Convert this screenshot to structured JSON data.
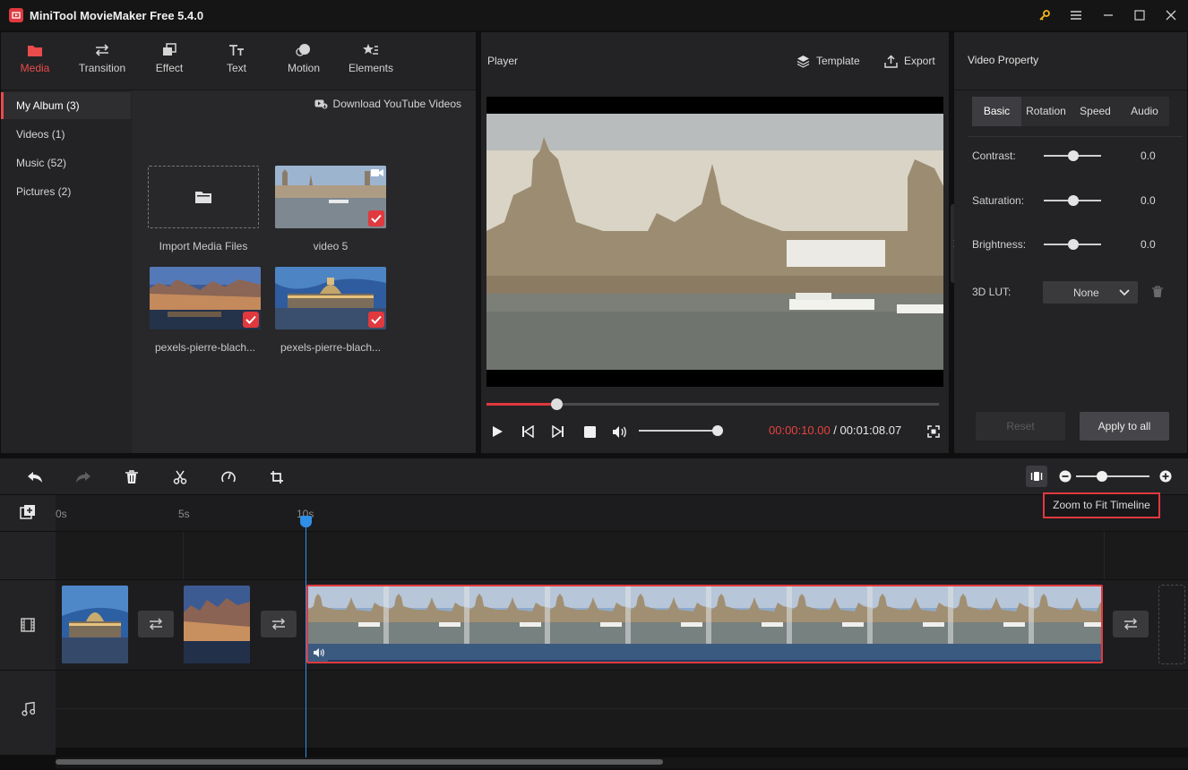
{
  "window": {
    "title": "MiniTool MovieMaker Free 5.4.0"
  },
  "toolbar": {
    "tabs": [
      {
        "label": "Media",
        "icon": "folder-icon"
      },
      {
        "label": "Transition",
        "icon": "transition-arrows-icon"
      },
      {
        "label": "Effect",
        "icon": "effect-icon"
      },
      {
        "label": "Text",
        "icon": "text-icon"
      },
      {
        "label": "Motion",
        "icon": "motion-icon"
      },
      {
        "label": "Elements",
        "icon": "elements-icon"
      }
    ]
  },
  "sidebar": {
    "items": [
      {
        "label": "My Album (3)"
      },
      {
        "label": "Videos (1)"
      },
      {
        "label": "Music (52)"
      },
      {
        "label": "Pictures (2)"
      }
    ]
  },
  "media": {
    "download_label": "Download YouTube Videos",
    "items": [
      {
        "caption": "Import Media Files"
      },
      {
        "caption": "video 5"
      },
      {
        "caption": "pexels-pierre-blach..."
      },
      {
        "caption": "pexels-pierre-blach..."
      }
    ]
  },
  "player": {
    "title": "Player",
    "template_label": "Template",
    "export_label": "Export",
    "current_time": "00:00:10.00",
    "separator": " / ",
    "total_time": "00:01:08.07",
    "progress": 0.155,
    "volume": 0.94
  },
  "properties": {
    "title": "Video Property",
    "tabs": [
      "Basic",
      "Rotation",
      "Speed",
      "Audio"
    ],
    "rows": [
      {
        "label": "Contrast:",
        "value": "0.0"
      },
      {
        "label": "Saturation:",
        "value": "0.0"
      },
      {
        "label": "Brightness:",
        "value": "0.0"
      }
    ],
    "lut_label": "3D LUT:",
    "lut_value": "None",
    "reset_label": "Reset",
    "apply_label": "Apply to all"
  },
  "timeline": {
    "tooltip": "Zoom to Fit Timeline",
    "ruler": [
      "0s",
      "5s",
      "10s"
    ]
  },
  "colors": {
    "accent": "#e0393e",
    "playhead": "#2f8fe6"
  }
}
